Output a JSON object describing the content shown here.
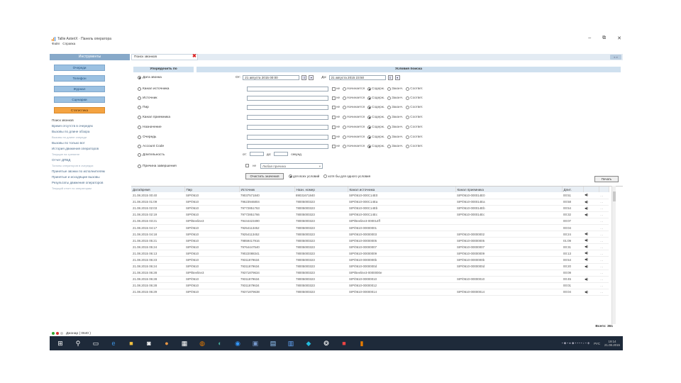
{
  "window": {
    "title": "Tallie AsteriX · Панель оператора",
    "minimize": "–",
    "restore": "⧉",
    "close": "✕"
  },
  "menu": [
    "Файл",
    "Справка"
  ],
  "sidebar": {
    "header": "Инструменты",
    "buttons": [
      {
        "label": "Очереди",
        "active": false
      },
      {
        "label": "Телефон",
        "active": false
      },
      {
        "label": "Журнал",
        "active": false
      },
      {
        "label": "Сценарии",
        "active": false
      },
      {
        "label": "Статистика",
        "active": true
      }
    ],
    "items": [
      "Поиск звонков",
      "Время отсутств в очередях",
      "Вызовы по длине обзора",
      "Вызовы по длине очереди",
      "Вызовы по только вот",
      "История движения операторов",
      "Текущие на тренинге",
      "Отчет ДПВД",
      "Талоны операторов в очередях",
      "Принятые звонки по исполнителям",
      "Принятые и исходящие вызовы",
      "Результаты движения операторов",
      "Текущий отчет по операторам"
    ]
  },
  "tabs": {
    "active_tab": "Поиск звонков",
    "close": "✖",
    "collapse": "« »"
  },
  "search": {
    "sort_header": "Упорядочить по",
    "conditions_header": "Условия поиска",
    "date_from_label": "От:",
    "date_from": "21 августа 2015 00:00",
    "date_to_label": "До:",
    "date_to": "21 августа 2015 23:50",
    "criteria": [
      {
        "label": "Дата звонка",
        "checked": true
      },
      {
        "label": "Канал источника",
        "checked": false
      },
      {
        "label": "Источник",
        "checked": false
      },
      {
        "label": "Пир",
        "checked": false
      },
      {
        "label": "Канал приемника",
        "checked": false
      },
      {
        "label": "Назначение",
        "checked": false
      },
      {
        "label": "Очередь",
        "checked": false
      },
      {
        "label": "Account Code",
        "checked": false
      },
      {
        "label": "Длительность",
        "checked": false
      },
      {
        "label": "Причина завершения",
        "checked": false
      }
    ],
    "match_not": "не",
    "match_options": [
      "Начинается",
      "Содерж.",
      "Заканч.",
      "Соответ."
    ],
    "match_selected": [
      1,
      1,
      1,
      1,
      1,
      1,
      1
    ],
    "duration_from": "от:",
    "duration_to": "до:",
    "duration_unit": "секунд",
    "reason_not": "не",
    "reason_value": "Любая причина",
    "clear_button": "Очистить значения",
    "all_conditions": "для всех условий",
    "any_condition": "хотя бы для одного условия",
    "print_button": "Печать"
  },
  "table": {
    "columns": [
      "Дата/время",
      "Пир",
      "Источник",
      "Назн. номер",
      "Канал источника",
      "Канал приемника",
      "Длит."
    ],
    "rows": [
      [
        "21.08.2015 00:40",
        "SIP/0610",
        "79037571840",
        "89031671840",
        "SIP/0610-000C14E0",
        "SIP/0610-000014E0",
        "00:51",
        "1"
      ],
      [
        "21.08.2015 01:09",
        "SIP/0610",
        "79623946804",
        "78005000323",
        "SIP/0610-000C14Ea",
        "SIP/0610-000014Ea",
        "00:58",
        "1"
      ],
      [
        "21.08.2015 02:03",
        "SIP/0610",
        "79772851763",
        "78005000323",
        "SIP/0610-000C14Eb",
        "SIP/0610-000014Eb",
        "00:54",
        "1"
      ],
      [
        "21.08.2015 02:19",
        "SIP/0610",
        "79772851766",
        "78005000323",
        "SIP/0610-000C14Ec",
        "SIP/0610-000014Ec",
        "00:32",
        "1"
      ],
      [
        "21.08.2015 03:21",
        "SIP/Beeline3",
        "79444423490",
        "78005000323",
        "SIP/Beeline3-000014ff",
        "",
        "00:07",
        "0"
      ],
      [
        "21.08.2015 04:17",
        "SIP/0610",
        "79254113452",
        "78005000323",
        "SIP/0610-00000001",
        "",
        "00:04",
        "0"
      ],
      [
        "21.08.2015 04:18",
        "SIP/0610",
        "79254113452",
        "78005000323",
        "SIP/0610-00000003",
        "SIP/0610-00000002",
        "00:24",
        "1"
      ],
      [
        "21.08.2015 05:21",
        "SIP/0610",
        "79859417916",
        "78005000323",
        "SIP/0610-00000005",
        "SIP/0610-00000005",
        "01:09",
        "1"
      ],
      [
        "21.08.2015 05:24",
        "SIP/0610",
        "79764447540",
        "78005000323",
        "SIP/0610-00000007",
        "SIP/0610-00000007",
        "00:31",
        "1"
      ],
      [
        "21.08.2015 06:13",
        "SIP/0610",
        "79022088341",
        "78005000323",
        "SIP/0610-00000009",
        "SIP/0610-00000009",
        "00:13",
        "1"
      ],
      [
        "21.08.2015 06:23",
        "SIP/0610",
        "79311879634",
        "78005000323",
        "SIP/0610-0000000b",
        "SIP/0610-0000000b",
        "00:54",
        "1"
      ],
      [
        "21.08.2015 06:24",
        "SIP/0610",
        "79311879634",
        "78005000323",
        "SIP/0610-0000000d",
        "SIP/0610-0000000d",
        "00:20",
        "1"
      ],
      [
        "21.08.2015 06:28",
        "SIP/Beeline3",
        "79371879634",
        "78005000323",
        "SIP/Beeline3-0000000e",
        "",
        "00:09",
        "0"
      ],
      [
        "21.08.2015 06:28",
        "SIP/0610",
        "79311879634",
        "78005000323",
        "SIP/0610-00000010",
        "SIP/0610-00000010",
        "00:45",
        "1"
      ],
      [
        "21.08.2015 06:28",
        "SIP/0610",
        "79311879634",
        "78005000323",
        "SIP/0610-00000012",
        "",
        "00:01",
        "0"
      ],
      [
        "21.08.2015 06:29",
        "SIP/0610",
        "79371879638",
        "78005000323",
        "SIP/0610-00000014",
        "SIP/0610-00000014",
        "00:04",
        "1"
      ]
    ],
    "total": "Всего: 361"
  },
  "status": {
    "text": "Джонар ( 0640 )"
  },
  "taskbar": {
    "icons": [
      "windows-icon",
      "search-icon",
      "task-view-icon",
      "edge-icon",
      "file-explorer-icon",
      "store-icon",
      "chrome-icon",
      "calculator-icon",
      "app1-icon",
      "app2-icon",
      "app3-icon",
      "app4-icon",
      "app5-icon",
      "app6-icon",
      "app7-icon",
      "app8-icon",
      "app9-icon"
    ],
    "lang": "РУС",
    "time": "19:14",
    "date": "21.08.2015"
  },
  "colors": {
    "sidebar_header": "#87a9c9",
    "button": "#9bc1e2",
    "button_active": "#f4a341",
    "taskbar": "#1e2a3a"
  }
}
